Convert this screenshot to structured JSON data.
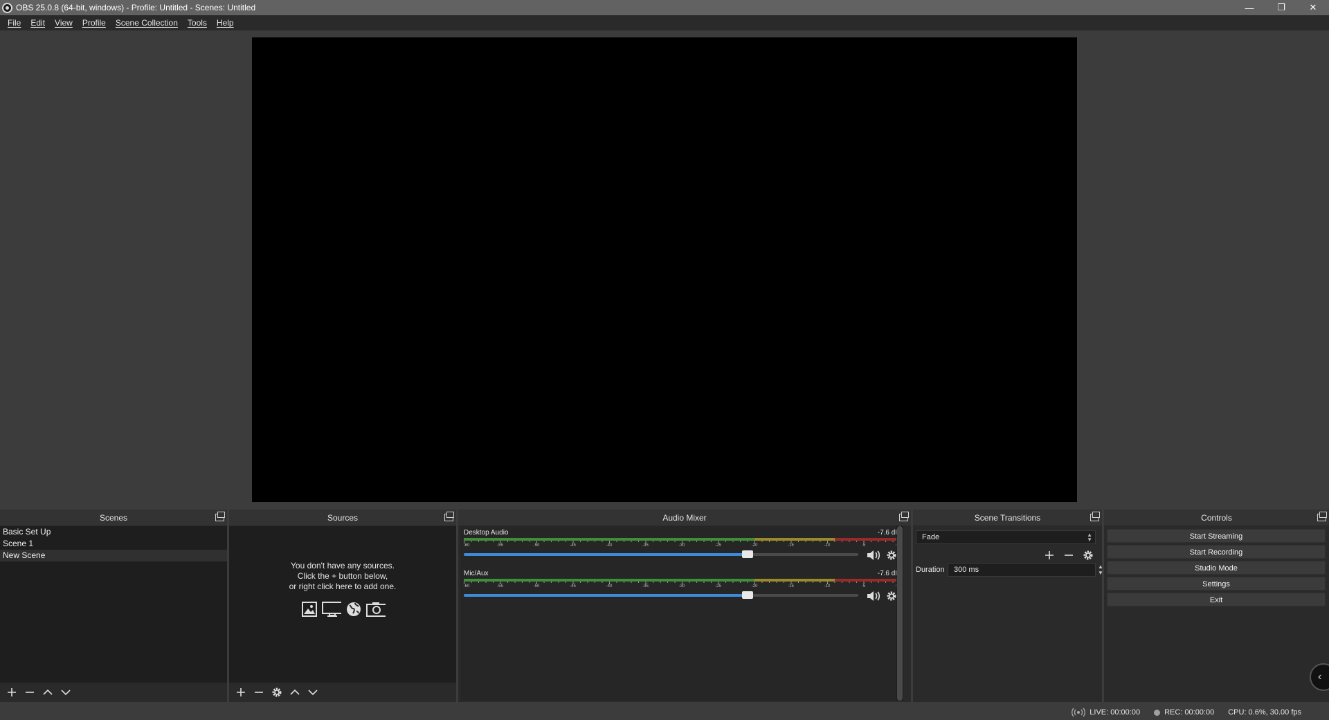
{
  "window": {
    "title": "OBS 25.0.8 (64-bit, windows) - Profile: Untitled - Scenes: Untitled",
    "minimize": "—",
    "restore": "❐",
    "close": "✕"
  },
  "menu": [
    "File",
    "Edit",
    "View",
    "Profile",
    "Scene Collection",
    "Tools",
    "Help"
  ],
  "scenes": {
    "title": "Scenes",
    "items": [
      "Basic Set Up",
      "Scene 1",
      "New Scene"
    ],
    "selected_index": 2
  },
  "sources": {
    "title": "Sources",
    "empty_line1": "You don't have any sources.",
    "empty_line2": "Click the + button below,",
    "empty_line3": "or right click here to add one."
  },
  "mixer": {
    "title": "Audio Mixer",
    "ticks": [
      "-60",
      "-55",
      "-50",
      "-45",
      "-40",
      "-35",
      "-30",
      "-25",
      "-20",
      "-15",
      "-10",
      "-5",
      "0"
    ],
    "channels": [
      {
        "name": "Desktop Audio",
        "db": "-7.6 dB",
        "volume": 0.72
      },
      {
        "name": "Mic/Aux",
        "db": "-7.6 dB",
        "volume": 0.72
      }
    ]
  },
  "transitions": {
    "title": "Scene Transitions",
    "selected": "Fade",
    "duration_label": "Duration",
    "duration_value": "300 ms"
  },
  "controls": {
    "title": "Controls",
    "start_streaming": "Start Streaming",
    "start_recording": "Start Recording",
    "studio_mode": "Studio Mode",
    "settings": "Settings",
    "exit": "Exit"
  },
  "status": {
    "live": "LIVE: 00:00:00",
    "rec": "REC: 00:00:00",
    "cpu": "CPU: 0.6%, 30.00 fps"
  },
  "colors": {
    "meter_green": "#3e8f35",
    "meter_yellow": "#9a8a2a",
    "meter_red": "#9a2a2a",
    "slider_blue": "#3f8ad6"
  }
}
